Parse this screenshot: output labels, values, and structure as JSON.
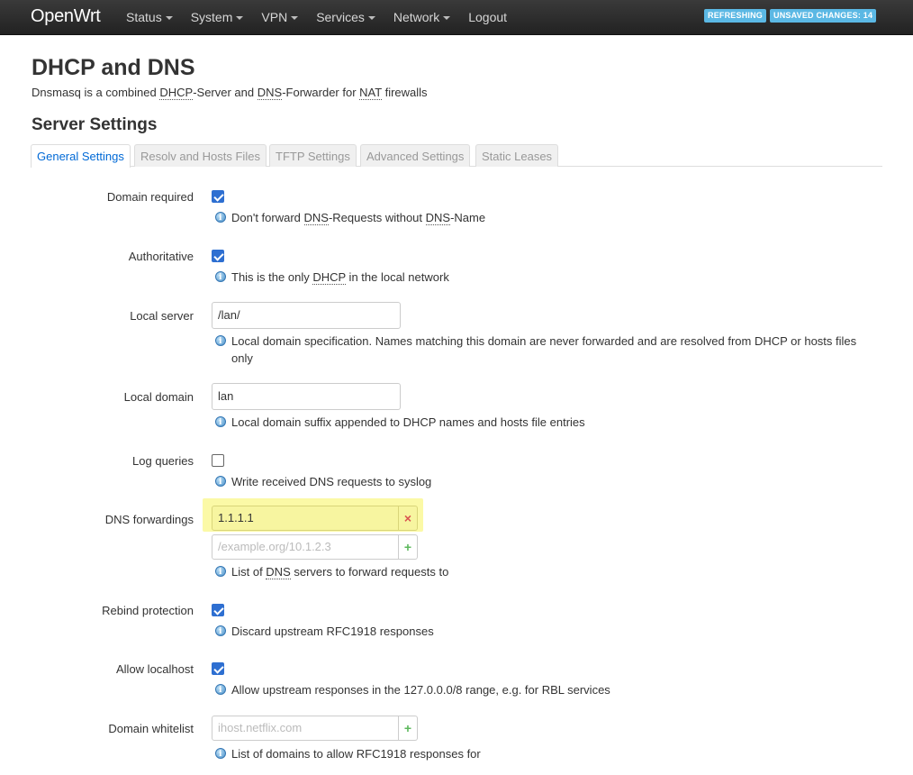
{
  "header": {
    "brand": "OpenWrt",
    "menu": [
      {
        "label": "Status",
        "has_dropdown": true
      },
      {
        "label": "System",
        "has_dropdown": true
      },
      {
        "label": "VPN",
        "has_dropdown": true
      },
      {
        "label": "Services",
        "has_dropdown": true
      },
      {
        "label": "Network",
        "has_dropdown": true
      },
      {
        "label": "Logout",
        "has_dropdown": false
      }
    ],
    "badges": {
      "refreshing": "REFRESHING",
      "unsaved": "UNSAVED CHANGES: 14",
      "color": "#5bb8e4"
    }
  },
  "page": {
    "title": "DHCP and DNS",
    "description": {
      "p1": "Dnsmasq is a combined ",
      "dhcp": "DHCP",
      "p2": "-Server and ",
      "dns": "DNS",
      "p3": "-Forwarder for ",
      "nat": "NAT",
      "p4": " firewalls"
    },
    "section_title": "Server Settings"
  },
  "tabs": [
    {
      "label": "General Settings",
      "active": true
    },
    {
      "label": "Resolv and Hosts Files",
      "active": false
    },
    {
      "label": "TFTP Settings",
      "active": false
    },
    {
      "label": "Advanced Settings",
      "active": false
    },
    {
      "label": "Static Leases",
      "active": false
    }
  ],
  "fields": {
    "domain_required": {
      "label": "Domain required",
      "checked": true,
      "help": {
        "p1": "Don't forward ",
        "abbr1": "DNS",
        "p2": "-Requests without ",
        "abbr2": "DNS",
        "p3": "-Name"
      }
    },
    "authoritative": {
      "label": "Authoritative",
      "checked": true,
      "help": {
        "p1": "This is the only ",
        "abbr1": "DHCP",
        "p2": " in the local network"
      }
    },
    "local_server": {
      "label": "Local server",
      "value": "/lan/",
      "help": "Local domain specification. Names matching this domain are never forwarded and are resolved from DHCP or hosts files only"
    },
    "local_domain": {
      "label": "Local domain",
      "value": "lan",
      "help": "Local domain suffix appended to DHCP names and hosts file entries"
    },
    "log_queries": {
      "label": "Log queries",
      "checked": false,
      "help": "Write received DNS requests to syslog"
    },
    "dns_forwardings": {
      "label": "DNS forwardings",
      "values": [
        "1.1.1.1"
      ],
      "remove_symbol": "×",
      "placeholder": "/example.org/10.1.2.3",
      "add_symbol": "+",
      "help": {
        "p1": "List of ",
        "abbr1": "DNS",
        "p2": " servers to forward requests to"
      }
    },
    "rebind_protection": {
      "label": "Rebind protection",
      "checked": true,
      "help": "Discard upstream RFC1918 responses"
    },
    "allow_localhost": {
      "label": "Allow localhost",
      "checked": true,
      "help": "Allow upstream responses in the 127.0.0.0/8 range, e.g. for RBL services"
    },
    "domain_whitelist": {
      "label": "Domain whitelist",
      "placeholder": "ihost.netflix.com",
      "add_symbol": "+",
      "help": "List of domains to allow RFC1918 responses for"
    }
  }
}
